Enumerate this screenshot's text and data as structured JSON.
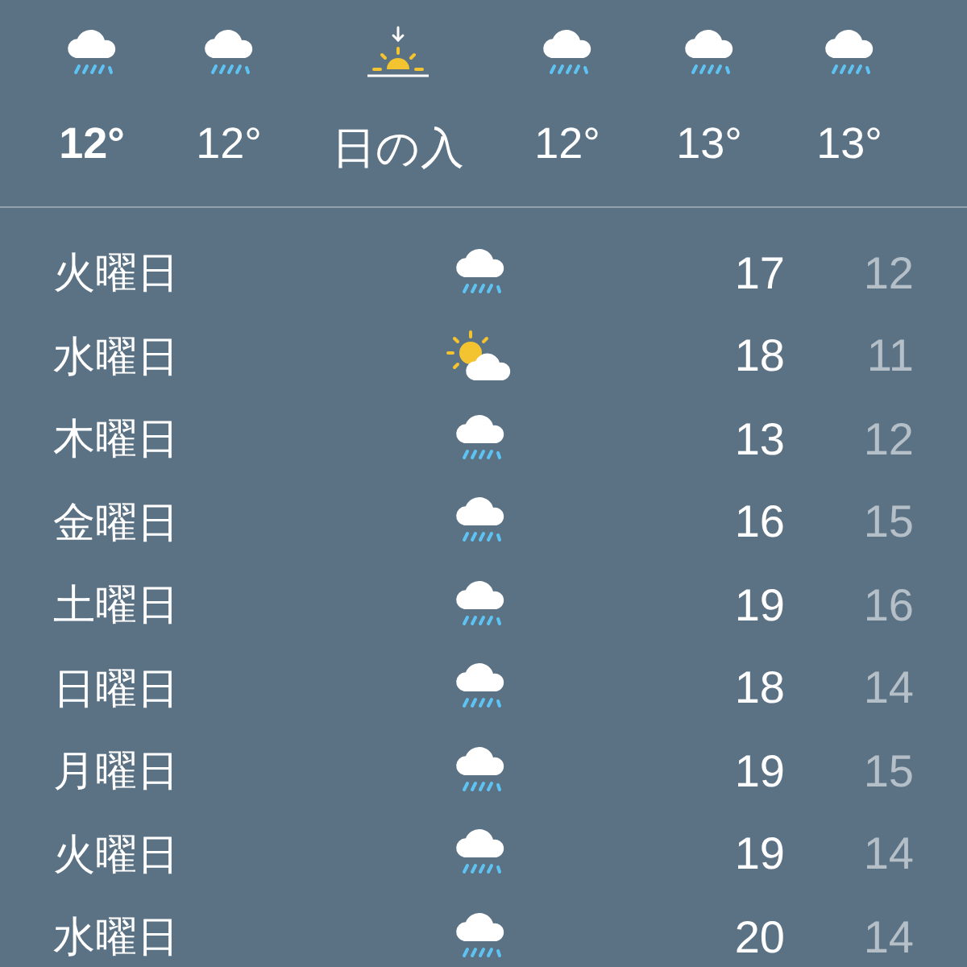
{
  "hourly": [
    {
      "kind": "rain",
      "label": "12°",
      "current": true
    },
    {
      "kind": "rain",
      "label": "12°",
      "current": false
    },
    {
      "kind": "sunset",
      "label": "日の入",
      "current": false
    },
    {
      "kind": "rain",
      "label": "12°",
      "current": false
    },
    {
      "kind": "rain",
      "label": "13°",
      "current": false
    },
    {
      "kind": "rain",
      "label": "13°",
      "current": false
    }
  ],
  "daily": [
    {
      "day": "火曜日",
      "kind": "rain",
      "high": "17",
      "low": "12"
    },
    {
      "day": "水曜日",
      "kind": "partly_sunny",
      "high": "18",
      "low": "11"
    },
    {
      "day": "木曜日",
      "kind": "rain",
      "high": "13",
      "low": "12"
    },
    {
      "day": "金曜日",
      "kind": "rain",
      "high": "16",
      "low": "15"
    },
    {
      "day": "土曜日",
      "kind": "rain",
      "high": "19",
      "low": "16"
    },
    {
      "day": "日曜日",
      "kind": "rain",
      "high": "18",
      "low": "14"
    },
    {
      "day": "月曜日",
      "kind": "rain",
      "high": "19",
      "low": "15"
    },
    {
      "day": "火曜日",
      "kind": "rain",
      "high": "19",
      "low": "14"
    },
    {
      "day": "水曜日",
      "kind": "rain",
      "high": "20",
      "low": "14"
    }
  ]
}
